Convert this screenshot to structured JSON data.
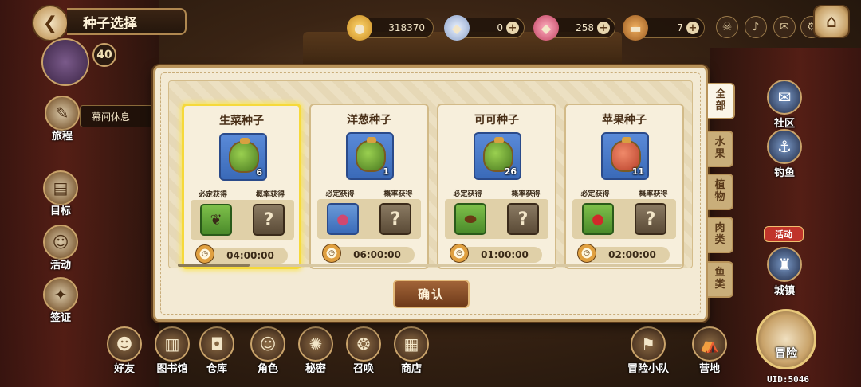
{
  "header": {
    "title": "种子选择",
    "back_icon": "back-arrow-icon",
    "level": "40"
  },
  "currencies": [
    {
      "name": "gold-coin-icon",
      "value": "318370",
      "has_plus": false,
      "color": "#e8a830"
    },
    {
      "name": "diamond-icon",
      "value": "0",
      "has_plus": true,
      "color": "#c0d0e8"
    },
    {
      "name": "crystal-icon",
      "value": "258",
      "has_plus": true,
      "color": "#e06880"
    },
    {
      "name": "bread-icon",
      "value": "7",
      "has_plus": true,
      "color": "#c8782a"
    }
  ],
  "left_menu": {
    "journey": "旅程",
    "rest": "幕间休息",
    "goal": "目标",
    "activity": "活动",
    "visa": "签证"
  },
  "right_menu": {
    "community": "社区",
    "fishing": "钓鱼",
    "activity_badge": "活动",
    "town": "城镇"
  },
  "bottom_menu": {
    "friends": "好友",
    "library": "图书馆",
    "warehouse": "仓库",
    "character": "角色",
    "secret": "秘密",
    "summon": "召唤",
    "shop": "商店",
    "party": "冒险小队",
    "camp": "营地",
    "adventure": "冒险"
  },
  "uid": "UID:5046",
  "dialog": {
    "confirm_label": "确认",
    "guaranteed_label": "必定获得",
    "chance_label": "概率获得",
    "cards": [
      {
        "title": "生菜种子",
        "qty": "6",
        "time": "04:00:00",
        "selected": true,
        "drop_icon": "lettuce-icon"
      },
      {
        "title": "洋葱种子",
        "qty": "1",
        "time": "06:00:00",
        "selected": false,
        "drop_icon": "onion-icon"
      },
      {
        "title": "可可种子",
        "qty": "26",
        "time": "01:00:00",
        "selected": false,
        "drop_icon": "cocoa-bean-icon"
      },
      {
        "title": "苹果种子",
        "qty": "11",
        "time": "02:00:00",
        "selected": false,
        "drop_icon": "apple-icon"
      }
    ],
    "unknown_glyph": "?"
  },
  "tabs": [
    {
      "label": "全部",
      "active": true
    },
    {
      "label": "水果",
      "active": false
    },
    {
      "label": "植物",
      "active": false
    },
    {
      "label": "肉类",
      "active": false
    },
    {
      "label": "鱼类",
      "active": false
    }
  ]
}
